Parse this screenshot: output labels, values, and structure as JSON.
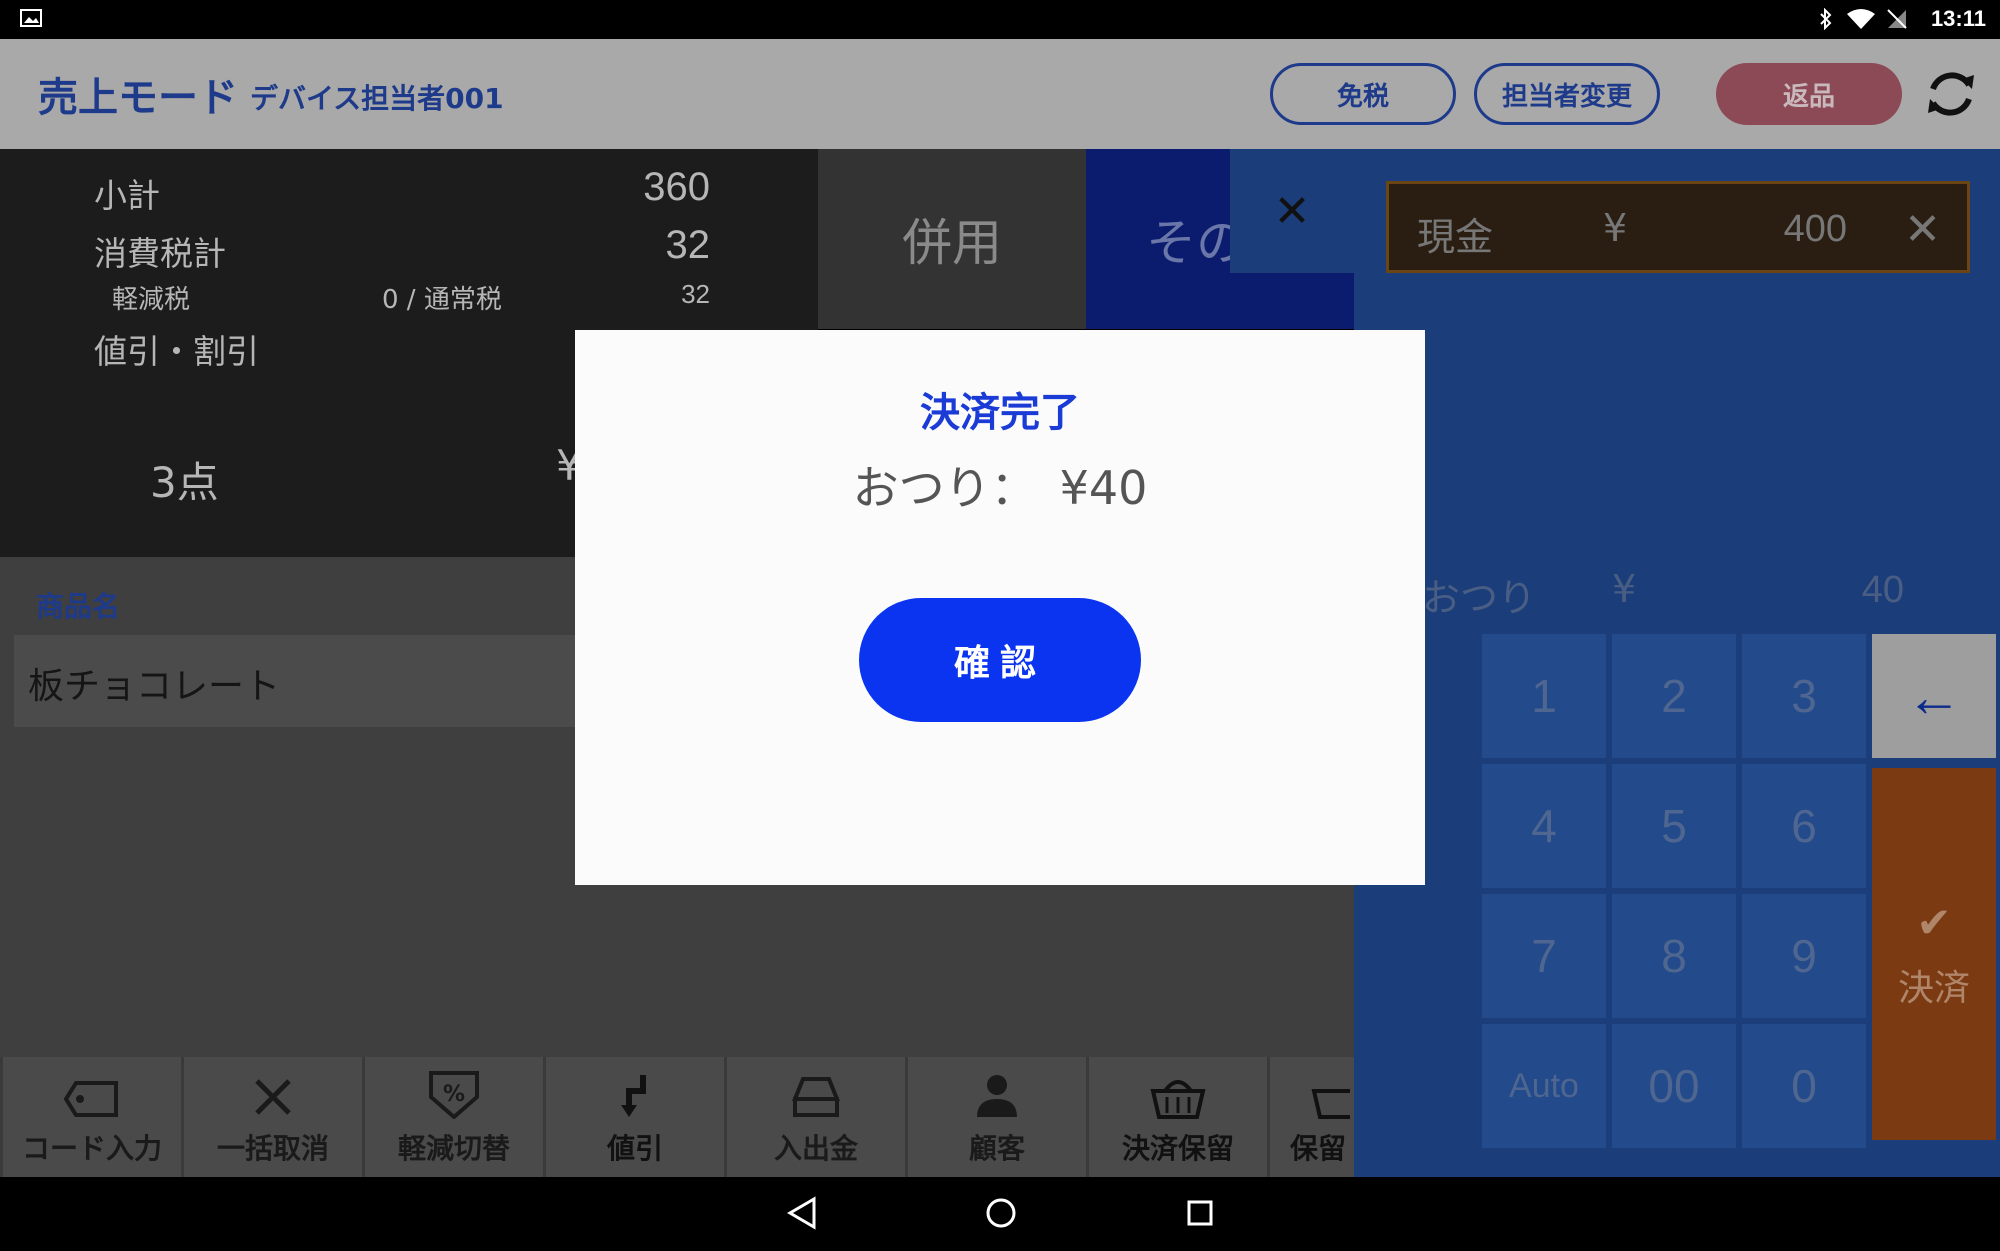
{
  "status_bar": {
    "time": "13:11"
  },
  "header": {
    "mode_title": "売上モード",
    "staff_name": "デバイス担当者001",
    "tax_free_label": "免税",
    "change_staff_label": "担当者変更",
    "return_label": "返品"
  },
  "summary": {
    "subtotal_label": "小計",
    "subtotal_value": "360",
    "tax_label": "消費税計",
    "tax_value": "32",
    "reduced_tax_label": "軽減税",
    "reduced_normal_label": "0 / 通常税",
    "normal_tax_value": "32",
    "discount_label": "値引・割引",
    "item_count": "3点",
    "yen_partial": "¥"
  },
  "tabs": {
    "combine_label": "併用",
    "other_label": "その"
  },
  "list": {
    "header": "商品名",
    "rows": [
      {
        "name": "板チョコレート"
      }
    ]
  },
  "payment": {
    "method_label": "現金",
    "currency": "¥",
    "amount": "400",
    "change_label": "おつり",
    "change_currency": "¥",
    "change_value": "40",
    "keys": [
      "1",
      "2",
      "3",
      "4",
      "5",
      "6",
      "7",
      "8",
      "9",
      "Auto",
      "00",
      "0"
    ],
    "pay_label": "決済"
  },
  "toolbar": {
    "items": [
      {
        "label": "コード入力"
      },
      {
        "label": "一括取消"
      },
      {
        "label": "軽減切替"
      },
      {
        "label": "値引"
      },
      {
        "label": "入出金"
      },
      {
        "label": "顧客"
      },
      {
        "label": "決済保留"
      },
      {
        "label": "保留"
      }
    ]
  },
  "modal": {
    "title": "決済完了",
    "change_text": "おつり：　¥40",
    "confirm_label": "確認"
  }
}
